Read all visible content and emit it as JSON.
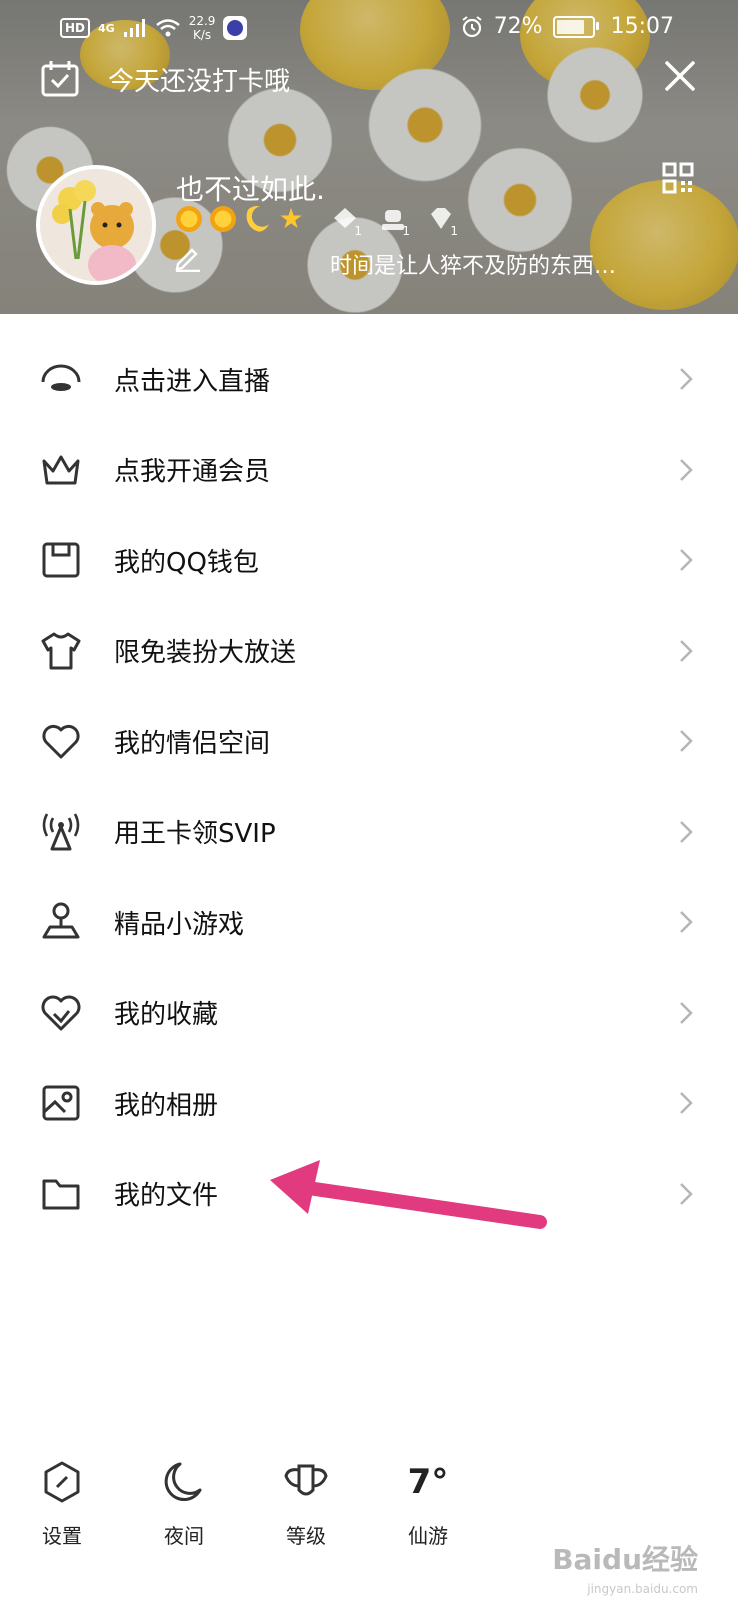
{
  "status_bar": {
    "hd": "HD",
    "network": "4G",
    "speed_value": "22.9",
    "speed_unit": "K/s",
    "battery": "72%",
    "battery_level": 0.72,
    "time": "15:07"
  },
  "header": {
    "checkin_text": "今天还没打卡哦",
    "nickname": "也不过如此.",
    "signature": "时间是让人猝不及防的东西…",
    "badge_counts": [
      "1",
      "1",
      "1"
    ]
  },
  "menu": {
    "items": [
      {
        "label": "点击进入直播",
        "icon": "live-icon"
      },
      {
        "label": "点我开通会员",
        "icon": "crown-icon"
      },
      {
        "label": "我的QQ钱包",
        "icon": "wallet-icon"
      },
      {
        "label": "限免装扮大放送",
        "icon": "tshirt-icon"
      },
      {
        "label": "我的情侣空间",
        "icon": "heart-icon"
      },
      {
        "label": "用王卡领SVIP",
        "icon": "signal-tower-icon"
      },
      {
        "label": "精品小游戏",
        "icon": "joystick-icon"
      },
      {
        "label": "我的收藏",
        "icon": "favorite-icon"
      },
      {
        "label": "我的相册",
        "icon": "photo-album-icon"
      },
      {
        "label": "我的文件",
        "icon": "folder-icon"
      }
    ]
  },
  "bottom_bar": {
    "settings": "设置",
    "night": "夜间",
    "level": "等级",
    "weather_temp": "7°",
    "weather_city": "仙游"
  },
  "watermark": {
    "text": "Baidu经验",
    "sub": "jingyan.baidu.com"
  },
  "colors": {
    "annotation_arrow": "#e23a7f",
    "icon": "#333333",
    "chevron": "#b5b5b5"
  }
}
